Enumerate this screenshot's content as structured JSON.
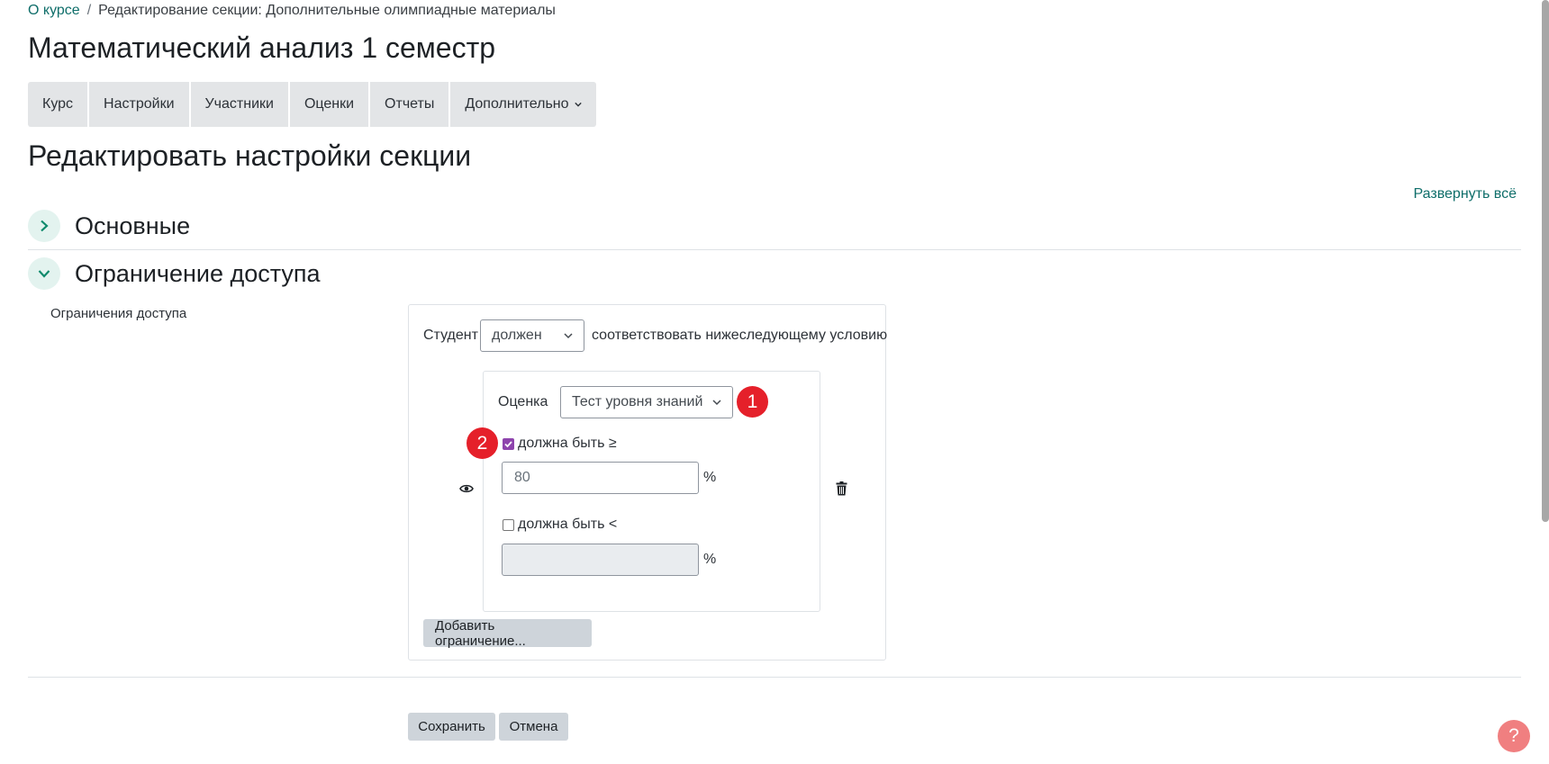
{
  "breadcrumb": {
    "link": "О курсе",
    "separator": "/",
    "current": "Редактирование секции: Дополнительные олимпиадные материалы"
  },
  "course_title": "Математический анализ 1 семестр",
  "course_nav": {
    "tabs": [
      {
        "label": "Курс"
      },
      {
        "label": "Настройки"
      },
      {
        "label": "Участники"
      },
      {
        "label": "Оценки"
      },
      {
        "label": "Отчеты"
      },
      {
        "label": "Дополнительно"
      }
    ]
  },
  "page_title": "Редактировать настройки секции",
  "expand_all": "Развернуть всё",
  "sections": {
    "general": {
      "title": "Основные",
      "icon": "chevron-right-icon"
    },
    "access": {
      "title": "Ограничение доступа",
      "icon": "chevron-down-icon"
    }
  },
  "restrictions": {
    "label": "Ограничения доступа",
    "student_label": "Студент",
    "must_select": "должен",
    "condition_text": "соответствовать нижеследующему условию",
    "grade_label": "Оценка",
    "grade_select": "Тест уровня знаний",
    "min_checkbox_label": "должна быть ≥",
    "min_checked": true,
    "min_value": "80",
    "max_checkbox_label": "должна быть <",
    "max_checked": false,
    "max_value": "",
    "percent": "%",
    "add_button": "Добавить ограничение..."
  },
  "annotations": {
    "badge1": "1",
    "badge2": "2"
  },
  "footer": {
    "save": "Сохранить",
    "cancel": "Отмена"
  },
  "help": "?",
  "colors": {
    "accent": "#0f6e6a",
    "badge": "#e5202a",
    "checkbox": "#8e44ad",
    "help": "#f07f80"
  }
}
